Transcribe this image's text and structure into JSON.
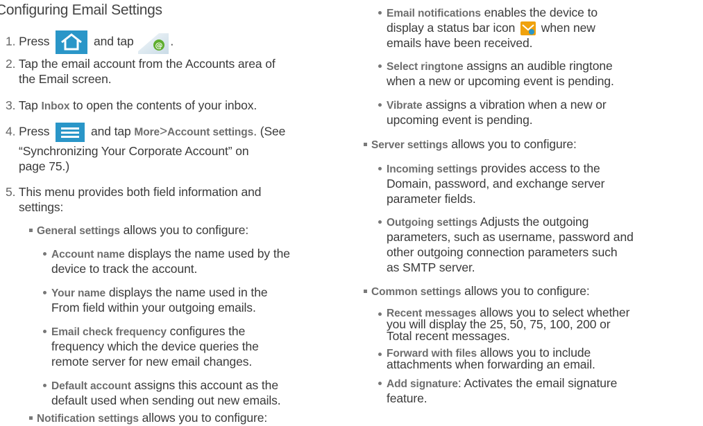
{
  "section_title": "Configuring Email Settings",
  "icons": {
    "home": "home-icon",
    "email_app": "email-app-icon",
    "menu": "menu-icon",
    "email_status": "email-status-icon",
    "home_color": "#2a96c8",
    "menu_color": "#2a96c8"
  },
  "steps": [
    {
      "num": "1.",
      "pre": "Press",
      "mid": "and tap",
      "post": "."
    },
    {
      "num": "2.",
      "l1": "Tap the email account from the Accounts area of",
      "l2": "the Email screen."
    },
    {
      "num": "3.",
      "pre": "Tap",
      "hl": "Inbox",
      "post": "to open the contents of your inbox."
    },
    {
      "num": "4.",
      "pre": "Press",
      "mid": "and tap",
      "hl1": "More",
      "sep": ">",
      "hl2": "Account settings",
      "post": ". (See",
      "l2": "“Synchronizing Your Corporate Account” on",
      "l3": "page 75.)"
    },
    {
      "num": "5.",
      "l1": "This menu provides both field information and",
      "l2": "settings:"
    }
  ],
  "general": {
    "heading": "General settings",
    "heading_rest": "allows you to configure:",
    "items": [
      {
        "hl": "Account name",
        "l1": "displays the name used by the",
        "l2": "device to track the account."
      },
      {
        "hl": "Your name",
        "l1": "displays the name used in the",
        "l2": "From field within your outgoing emails."
      },
      {
        "hl": "Email check frequency",
        "l1": "configures the",
        "l2": "frequency which the device queries the",
        "l3": "remote server for new email changes."
      },
      {
        "hl": "Default account",
        "l1": "assigns this account as the",
        "l2": "default used when sending out new emails."
      }
    ]
  },
  "notification": {
    "heading": "Notification settings",
    "heading_rest": "allows you to configure:",
    "items": [
      {
        "hl": "Email notifications",
        "l1": "enables the device to",
        "l2a": "display a status bar icon",
        "l2b": "when new",
        "l3": "emails have been received."
      },
      {
        "hl": "Select ringtone",
        "l1": "assigns an audible ringtone",
        "l2": "when a new or upcoming event is pending."
      },
      {
        "hl": "Vibrate",
        "l1": "assigns a vibration when a new or",
        "l2": "upcoming event is pending."
      }
    ]
  },
  "server": {
    "heading": "Server settings",
    "heading_rest": "allows you to configure:",
    "items": [
      {
        "hl": "Incoming settings",
        "l1": "provides access to the",
        "l2": "Domain, password, and exchange server",
        "l3": "parameter fields."
      },
      {
        "hl": "Outgoing settings",
        "l1": "Adjusts the outgoing",
        "l2": "parameters, such as username, password and",
        "l3": "other outgoing connection parameters such",
        "l4": "as SMTP server."
      }
    ]
  },
  "common": {
    "heading": "Common settings",
    "heading_rest": "allows you to configure:",
    "items": [
      {
        "hl": "Recent messages",
        "l1": "allows you to select whether",
        "l2": "you will display the 25, 50, 75, 100, 200 or",
        "l3": "Total recent messages."
      },
      {
        "hl": "Forward with files",
        "l1": "allows you to include",
        "l2": "attachments when forwarding an email."
      },
      {
        "hl": "Add signature",
        "l1": ": Activates the email signature",
        "l2": "feature."
      }
    ]
  }
}
